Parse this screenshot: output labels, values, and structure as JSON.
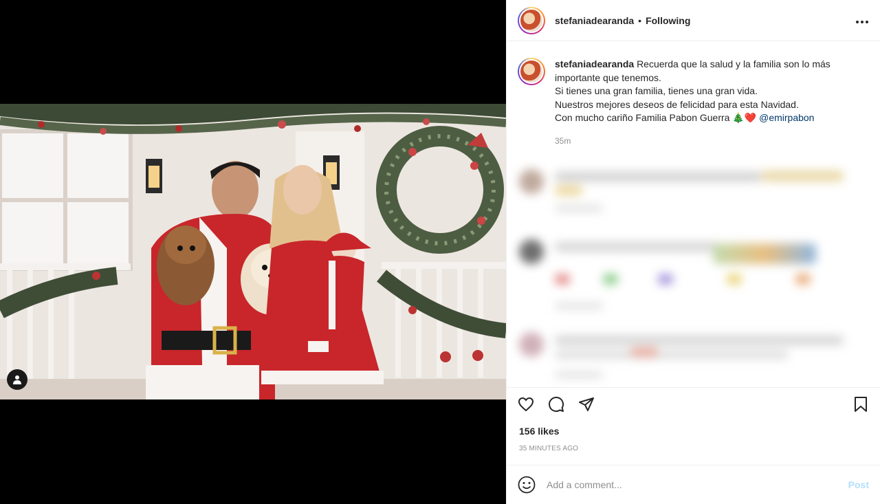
{
  "post": {
    "username": "stefaniadearanda",
    "follow_status": "Following",
    "dot": "•",
    "more_icon": "more-horizontal-icon",
    "caption_lines": [
      "Recuerda que la salud y la familia son lo más importante que tenemos.",
      "Si tienes una gran familia, tienes una gran vida.",
      "Nuestros mejores deseos de felicidad para esta Navidad.",
      "Con mucho cariño Familia Pabon Guerra 🎄❤️"
    ],
    "mention": "@emirpabon",
    "time": "35m",
    "likes": "156 likes",
    "posted_ago": "35 minutes ago"
  },
  "comment_box": {
    "placeholder": "Add a comment...",
    "post_label": "Post"
  },
  "colors": {
    "link": "#00376b",
    "muted": "#8e8e8e",
    "post_disabled": "#b2dffc"
  }
}
